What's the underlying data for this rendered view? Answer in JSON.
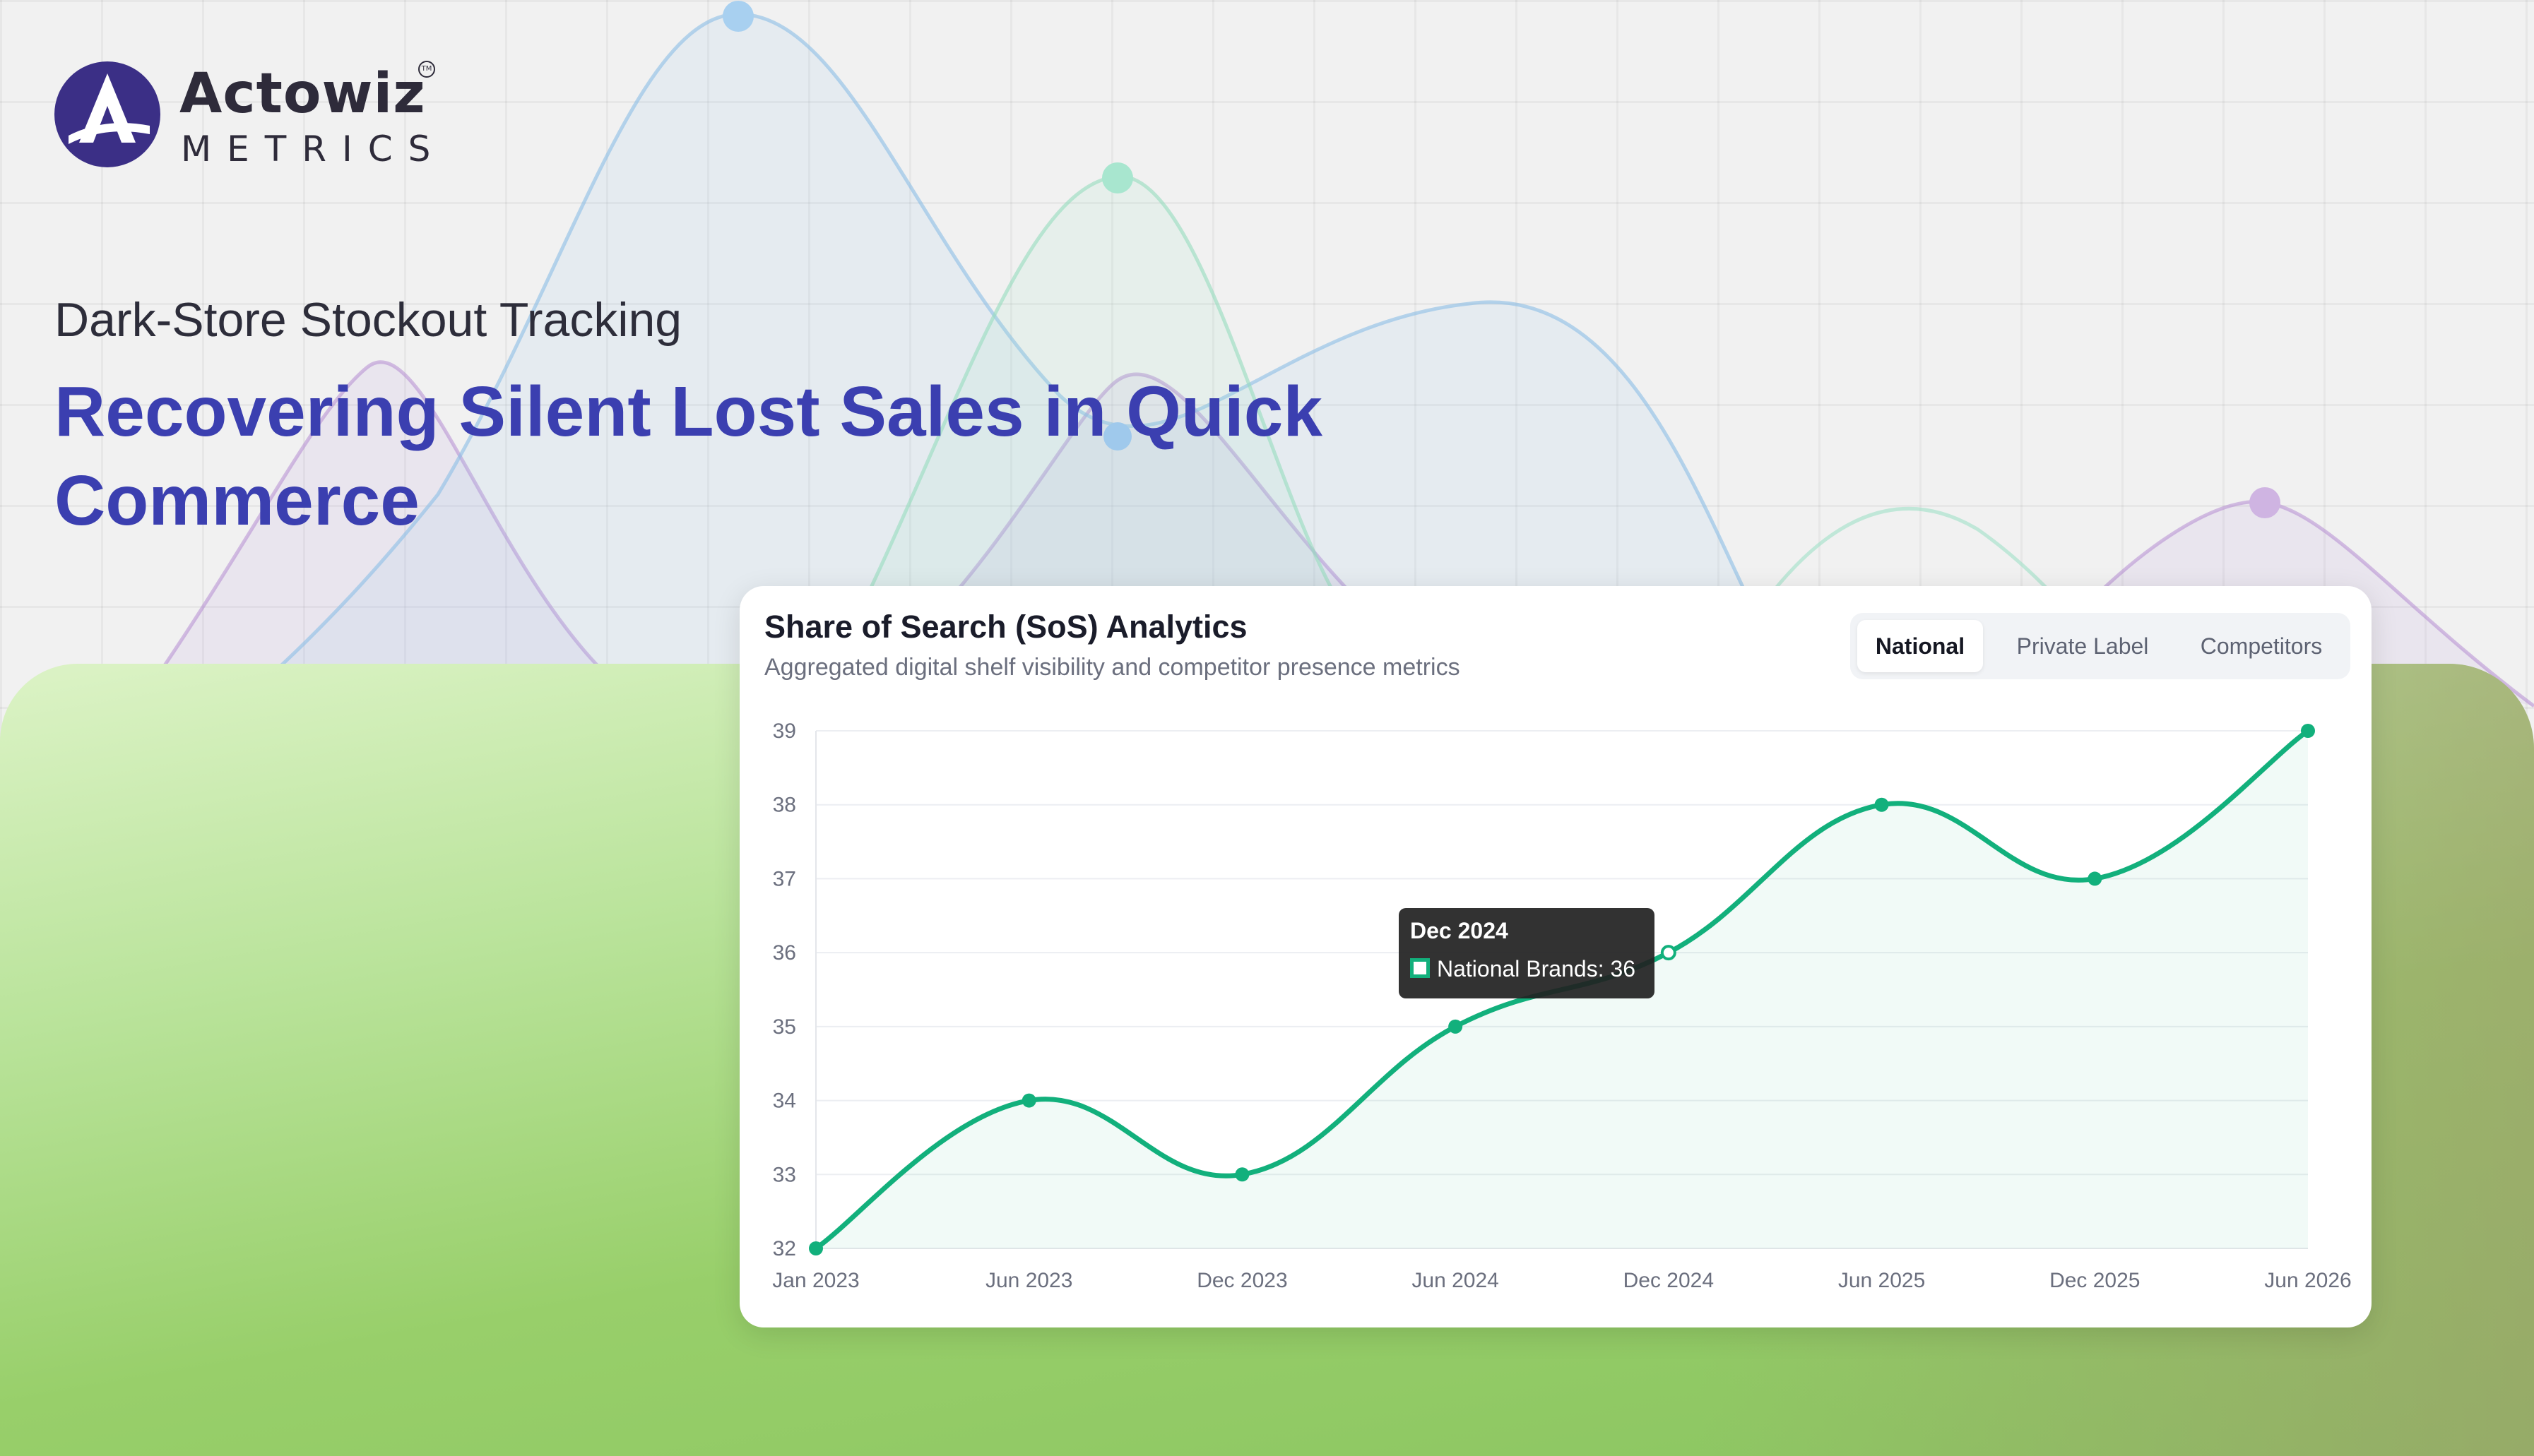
{
  "brand": {
    "name": "Actowiz",
    "sub": "METRICS",
    "tm": "TM"
  },
  "hero": {
    "kicker": "Dark-Store Stockout Tracking",
    "headline": "Recovering Silent Lost Sales in Quick Commerce"
  },
  "colors": {
    "headline": "#3b3fb0",
    "line": "#12b07c",
    "logo": "#3b2f86"
  },
  "card": {
    "title": "Share of Search (SoS) Analytics",
    "subtitle": "Aggregated digital shelf visibility and competitor presence metrics",
    "tabs": [
      {
        "label": "National",
        "active": true
      },
      {
        "label": "Private Label",
        "active": false
      },
      {
        "label": "Competitors",
        "active": false
      }
    ],
    "tooltip": {
      "title": "Dec 2024",
      "body": "National Brands: 36"
    }
  },
  "chart_data": {
    "type": "line",
    "x": [
      "Jan 2023",
      "Jun 2023",
      "Dec 2023",
      "Jun 2024",
      "Dec 2024",
      "Jun 2025",
      "Dec 2025",
      "Jun 2026"
    ],
    "series": [
      {
        "name": "National Brands",
        "values": [
          32,
          34,
          33,
          35,
          36,
          38,
          37,
          39
        ]
      }
    ],
    "ylim": [
      32,
      39
    ],
    "yticks": [
      32,
      33,
      34,
      35,
      36,
      37,
      38,
      39
    ],
    "grid": true,
    "smooth": true,
    "area_fill": true,
    "highlighted_index": 4
  }
}
